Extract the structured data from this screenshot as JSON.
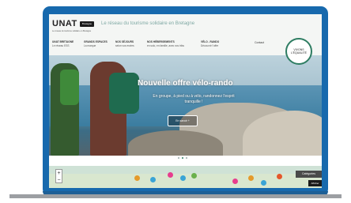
{
  "header": {
    "logo": "UNAT",
    "logo_badge": "Bretagne",
    "logo_sub": "Le réseau du tourisme solidaire en Bretagne",
    "tagline": "Le réseau du tourisme solidaire en Bretagne",
    "nav": [
      {
        "title": "UNAT BRETAGNE",
        "sub": "Le réseau ESS"
      },
      {
        "title": "GRANDS ESPACES",
        "sub": "La marque"
      },
      {
        "title": "NOS SÉJOURS",
        "sub": "selon vos envies"
      },
      {
        "title": "NOS HÉBERGEMENTS",
        "sub": "en solo, en famille, avec vos tribu"
      },
      {
        "title": "VÉLO - RANDO",
        "sub": "Découvrir l'offre"
      }
    ],
    "contact": "Contact",
    "stamp": "VIVONS L'ÉQUALITÉ"
  },
  "hero": {
    "title": "Nouvelle offre vélo-rando",
    "subtitle": "En groupe, à pied ou à vélo, randonnez l'esprit tranquille !",
    "button": "En savoir +"
  },
  "map": {
    "zoom_in": "+",
    "zoom_out": "−",
    "categories": "Catégories",
    "afficher": "Afficher"
  },
  "colors": {
    "laptop": "#1769ad",
    "accent": "#2e7d62"
  }
}
